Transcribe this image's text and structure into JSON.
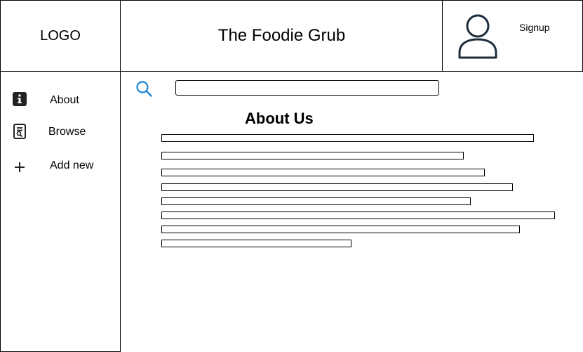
{
  "header": {
    "logo_text": "LOGO",
    "site_title": "The Foodie Grub",
    "signup_label": "Signup"
  },
  "sidebar": {
    "items": [
      {
        "label": "About",
        "icon": "info-icon"
      },
      {
        "label": "Browse",
        "icon": "document-search-icon"
      },
      {
        "label": "Add new",
        "icon": "plus-icon"
      }
    ]
  },
  "search": {
    "placeholder": "",
    "value": ""
  },
  "main": {
    "title": "About Us"
  }
}
